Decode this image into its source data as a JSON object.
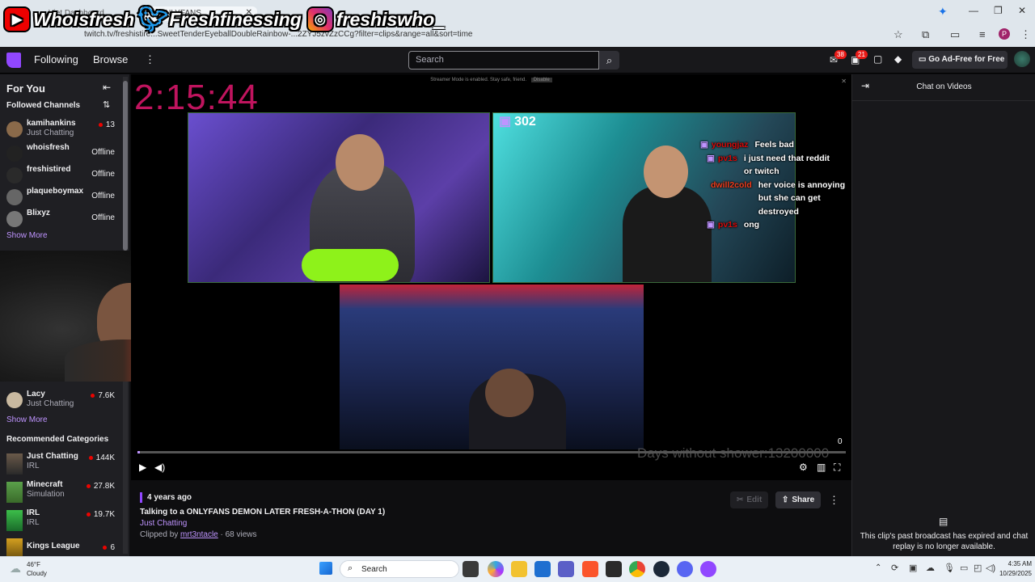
{
  "browser": {
    "tab_title": "a ONLYFANS",
    "tab_other": "Viet Dashboard",
    "url": "twitch.tv/freshistire...SweetTenderEyeballDoubleRainbow-...2ZYJ5zvZzCCg?filter=clips&range=all&sort=time",
    "profile_initial": "P"
  },
  "banner": {
    "youtube": "Whoisfresh",
    "twitter": "Freshfinessing",
    "instagram": "freshiswho_"
  },
  "topnav": {
    "following": "Following",
    "browse": "Browse",
    "search_placeholder": "Search",
    "inbox_badge": "38",
    "notif_badge": "21",
    "cta": "Go Ad-Free for Free"
  },
  "sidebar": {
    "for_you": "For You",
    "followed": "Followed Channels",
    "channels": [
      {
        "name": "kamihankins",
        "sub": "Just Chatting",
        "stat": "13",
        "live": true
      },
      {
        "name": "whoisfresh",
        "sub": "",
        "stat": "Offline",
        "live": false
      },
      {
        "name": "freshistired",
        "sub": "",
        "stat": "Offline",
        "live": false
      },
      {
        "name": "plaqueboymax",
        "sub": "",
        "stat": "Offline",
        "live": false
      },
      {
        "name": "Blixyz",
        "sub": "",
        "stat": "Offline",
        "live": false
      }
    ],
    "show_more_1": "Show More",
    "lacy": {
      "name": "Lacy",
      "sub": "Just Chatting",
      "stat": "7.6K"
    },
    "show_more_2": "Show More",
    "rec_categories": "Recommended Categories",
    "categories": [
      {
        "name": "Just Chatting",
        "sub": "IRL",
        "stat": "144K"
      },
      {
        "name": "Minecraft",
        "sub": "Simulation",
        "stat": "27.8K"
      },
      {
        "name": "IRL",
        "sub": "IRL",
        "stat": "19.7K"
      },
      {
        "name": "Kings League",
        "sub": "",
        "stat": "6"
      }
    ]
  },
  "player": {
    "streamer_mode": "Streamer Mode is enabled. Stay safe, friend.",
    "disable": "Disable",
    "timer": "2:15:44",
    "viewer_count": "302",
    "overlay_text": "Days without shower:13200000",
    "time_right": "0",
    "chat": [
      {
        "user": "youngjaz",
        "msg": "Feels bad"
      },
      {
        "user": "pv1s",
        "msg": "i just need that reddit or twitch"
      },
      {
        "user": "dwill2cold",
        "msg": "her voice is annoying but she can get destroyed"
      },
      {
        "user": "pv1s",
        "msg": "ong"
      }
    ]
  },
  "clip": {
    "age": "4 years ago",
    "title": "Talking to a ONLYFANS DEMON LATER FRESH-A-THON (DAY 1)",
    "category": "Just Chatting",
    "clipped_by_label": "Clipped by",
    "clipper": "mrt3ntacle",
    "views": "· 68 views",
    "edit": "Edit",
    "share": "Share"
  },
  "chatpanel": {
    "title": "Chat on Videos",
    "expired": "This clip's past broadcast has expired and chat replay is no longer available."
  },
  "taskbar": {
    "weather_temp": "46°F",
    "weather_desc": "Cloudy",
    "search": "Search",
    "time": "4:35 AM",
    "date": "10/29/2025"
  }
}
